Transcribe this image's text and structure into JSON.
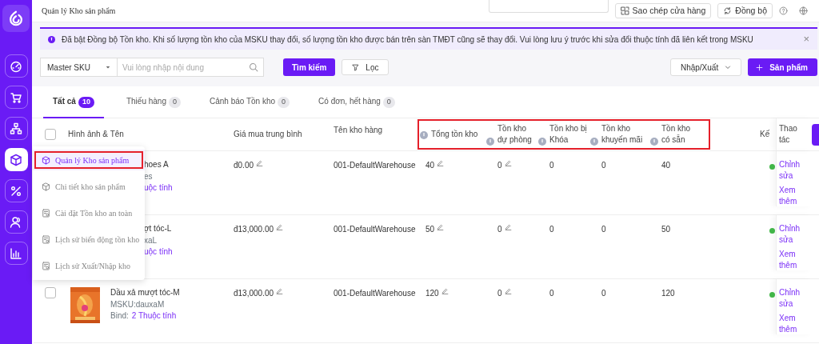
{
  "header": {
    "title": "Quản lý Kho sản phẩm",
    "buttons": [
      {
        "kind": "copy",
        "label": "Sao chép cửa hàng"
      },
      {
        "kind": "sync",
        "label": "Đồng bộ"
      }
    ],
    "icons": [
      {
        "kind": "help"
      },
      {
        "kind": "globe"
      }
    ]
  },
  "sidebar": {
    "items": [
      {
        "kind": "gauge",
        "selected": false
      },
      {
        "kind": "cart",
        "selected": false
      },
      {
        "kind": "tree",
        "selected": false
      },
      {
        "kind": "cube",
        "selected": true
      },
      {
        "kind": "percent",
        "selected": false
      },
      {
        "kind": "users",
        "selected": false
      },
      {
        "kind": "chart",
        "selected": false
      }
    ]
  },
  "notice": {
    "text": "Đã bật Đồng bộ Tồn kho. Khi số lượng tồn kho của MSKU thay đổi, số lượng tồn kho được bán trên sàn TMĐT cũng sẽ thay đổi. Vui lòng lưu ý trước khi sửa đổi thuộc tính đã liên kết trong MSKU",
    "close": "×"
  },
  "toolbar": {
    "field_select": "Master SKU",
    "placeholder": "Vui lòng nhập nội dung",
    "search_button": "Tìm kiếm",
    "filter_button": "Lọc",
    "io_button": "Nhập/Xuất",
    "add_button": "Sản phẩm"
  },
  "tabs": [
    {
      "label": "Tất cả",
      "count": "10",
      "selected": true
    },
    {
      "label": "Thiếu hàng",
      "count": "0",
      "selected": false
    },
    {
      "label": "Cảnh báo Tồn kho",
      "count": "0",
      "selected": false
    },
    {
      "label": "Có đơn, hết hàng",
      "count": "0",
      "selected": false
    }
  ],
  "table": {
    "select_all": {
      "checked": false
    },
    "columns": [
      {
        "label": "Hình ảnh & Tên",
        "info": false
      },
      {
        "label": "Giá mua trung bình",
        "info": false
      },
      {
        "label": "Tên kho hàng",
        "info": false
      },
      {
        "label": "Tổng tồn kho",
        "info": true
      },
      {
        "label": "Tồn kho dự phòng",
        "info": true
      },
      {
        "label": "Tồn kho bị Khóa",
        "info": true
      },
      {
        "label": "Tồn kho khuyến mãi",
        "info": true
      },
      {
        "label": "Tồn kho có sẵn",
        "info": true
      },
      {
        "label": "Kế",
        "info": false
      },
      {
        "label": "Thao tác",
        "info": false
      }
    ],
    "rows": [
      {
        "kind": "partial",
        "name": "hoes A",
        "sku": "es",
        "bind_link": "uộc tính",
        "price": "đ0.00",
        "warehouse": "001-DefaultWarehouse",
        "total": "40",
        "reserve": "0",
        "locked": "0",
        "promo": "0",
        "available": "40",
        "color": "#43b94a",
        "actions": [
          "Chỉnh sửa",
          "Xem thêm"
        ]
      },
      {
        "kind": "partial",
        "name": "ợt tóc-L",
        "sku": "xaL",
        "bind_link": "uộc tính",
        "price": "đ13,000.00",
        "warehouse": "001-DefaultWarehouse",
        "total": "50",
        "reserve": "0",
        "locked": "0",
        "promo": "0",
        "available": "50",
        "color": "#43b94a",
        "actions": [
          "Chỉnh sửa",
          "Xem thêm"
        ]
      },
      {
        "kind": "full",
        "checked": false,
        "name": "Dầu xả mượt tóc-M",
        "sku": "MSKU:dauxaM",
        "bind_label": "Bind:",
        "bind_link": "2 Thuộc tính",
        "price": "đ13,000.00",
        "warehouse": "001-DefaultWarehouse",
        "total": "120",
        "reserve": "0",
        "locked": "0",
        "promo": "0",
        "available": "120",
        "color": "#43b94a",
        "actions": [
          "Chỉnh sửa",
          "Xem thêm"
        ]
      }
    ]
  },
  "menu": {
    "items": [
      {
        "kind": "cube",
        "label": "Quản lý Kho sản phẩm",
        "selected": true
      },
      {
        "kind": "cube",
        "label": "Chi tiết kho sản phẩm",
        "selected": false
      },
      {
        "kind": "sheet",
        "label": "Cài đặt Tồn kho an toàn",
        "selected": false
      },
      {
        "kind": "sheet",
        "label": "Lịch sử biến động tồn kho",
        "selected": false
      },
      {
        "kind": "sheet",
        "label": "Lịch sử Xuất/Nhập kho",
        "selected": false
      }
    ]
  }
}
